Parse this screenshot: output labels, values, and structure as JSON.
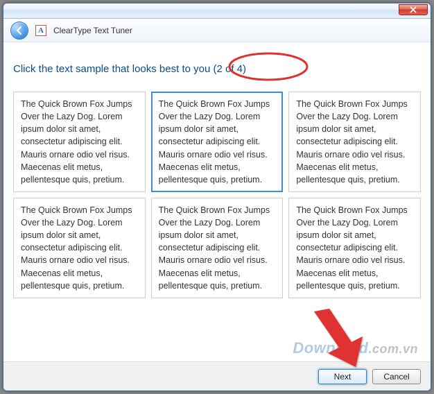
{
  "app_title": "ClearType Text Tuner",
  "heading_prefix": "Click the text sample that looks best to you ",
  "heading_step": "(2 of 4)",
  "step_current": 2,
  "step_total": 4,
  "sample_text": "The Quick Brown Fox Jumps Over the Lazy Dog. Lorem ipsum dolor sit amet, consectetur adipiscing elit. Mauris ornare odio vel risus. Maecenas elit metus, pellentesque quis, pretium.",
  "selected_index": 1,
  "buttons": {
    "next": "Next",
    "cancel": "Cancel"
  },
  "watermark": {
    "brand": "Download",
    "ext": ".com.vn"
  },
  "colors": {
    "heading": "#0b4b8f",
    "selection_border": "#3b8dd6",
    "annotation_red": "#e03030"
  }
}
